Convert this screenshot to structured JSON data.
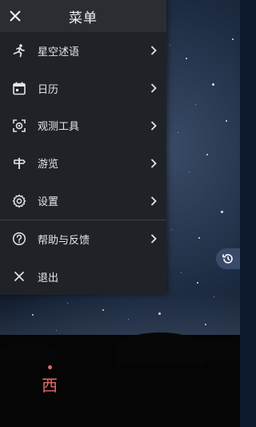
{
  "drawer": {
    "title": "菜单",
    "items": [
      {
        "label": "星空述语",
        "icon": "running-figure-icon"
      },
      {
        "label": "日历",
        "icon": "calendar-icon"
      },
      {
        "label": "观测工具",
        "icon": "target-tool-icon"
      },
      {
        "label": "游览",
        "icon": "signpost-icon"
      },
      {
        "label": "设置",
        "icon": "gear-icon"
      }
    ],
    "bottom_items": [
      {
        "label": "帮助与反馈",
        "icon": "help-circle-icon"
      },
      {
        "label": "退出",
        "icon": "close-icon"
      }
    ]
  },
  "sky": {
    "compass_direction": "西"
  },
  "colors": {
    "drawer_bg": "#1f2328",
    "header_bg": "#2a2e33",
    "compass": "#e26a6a",
    "history_button": "#3a4a6a"
  }
}
